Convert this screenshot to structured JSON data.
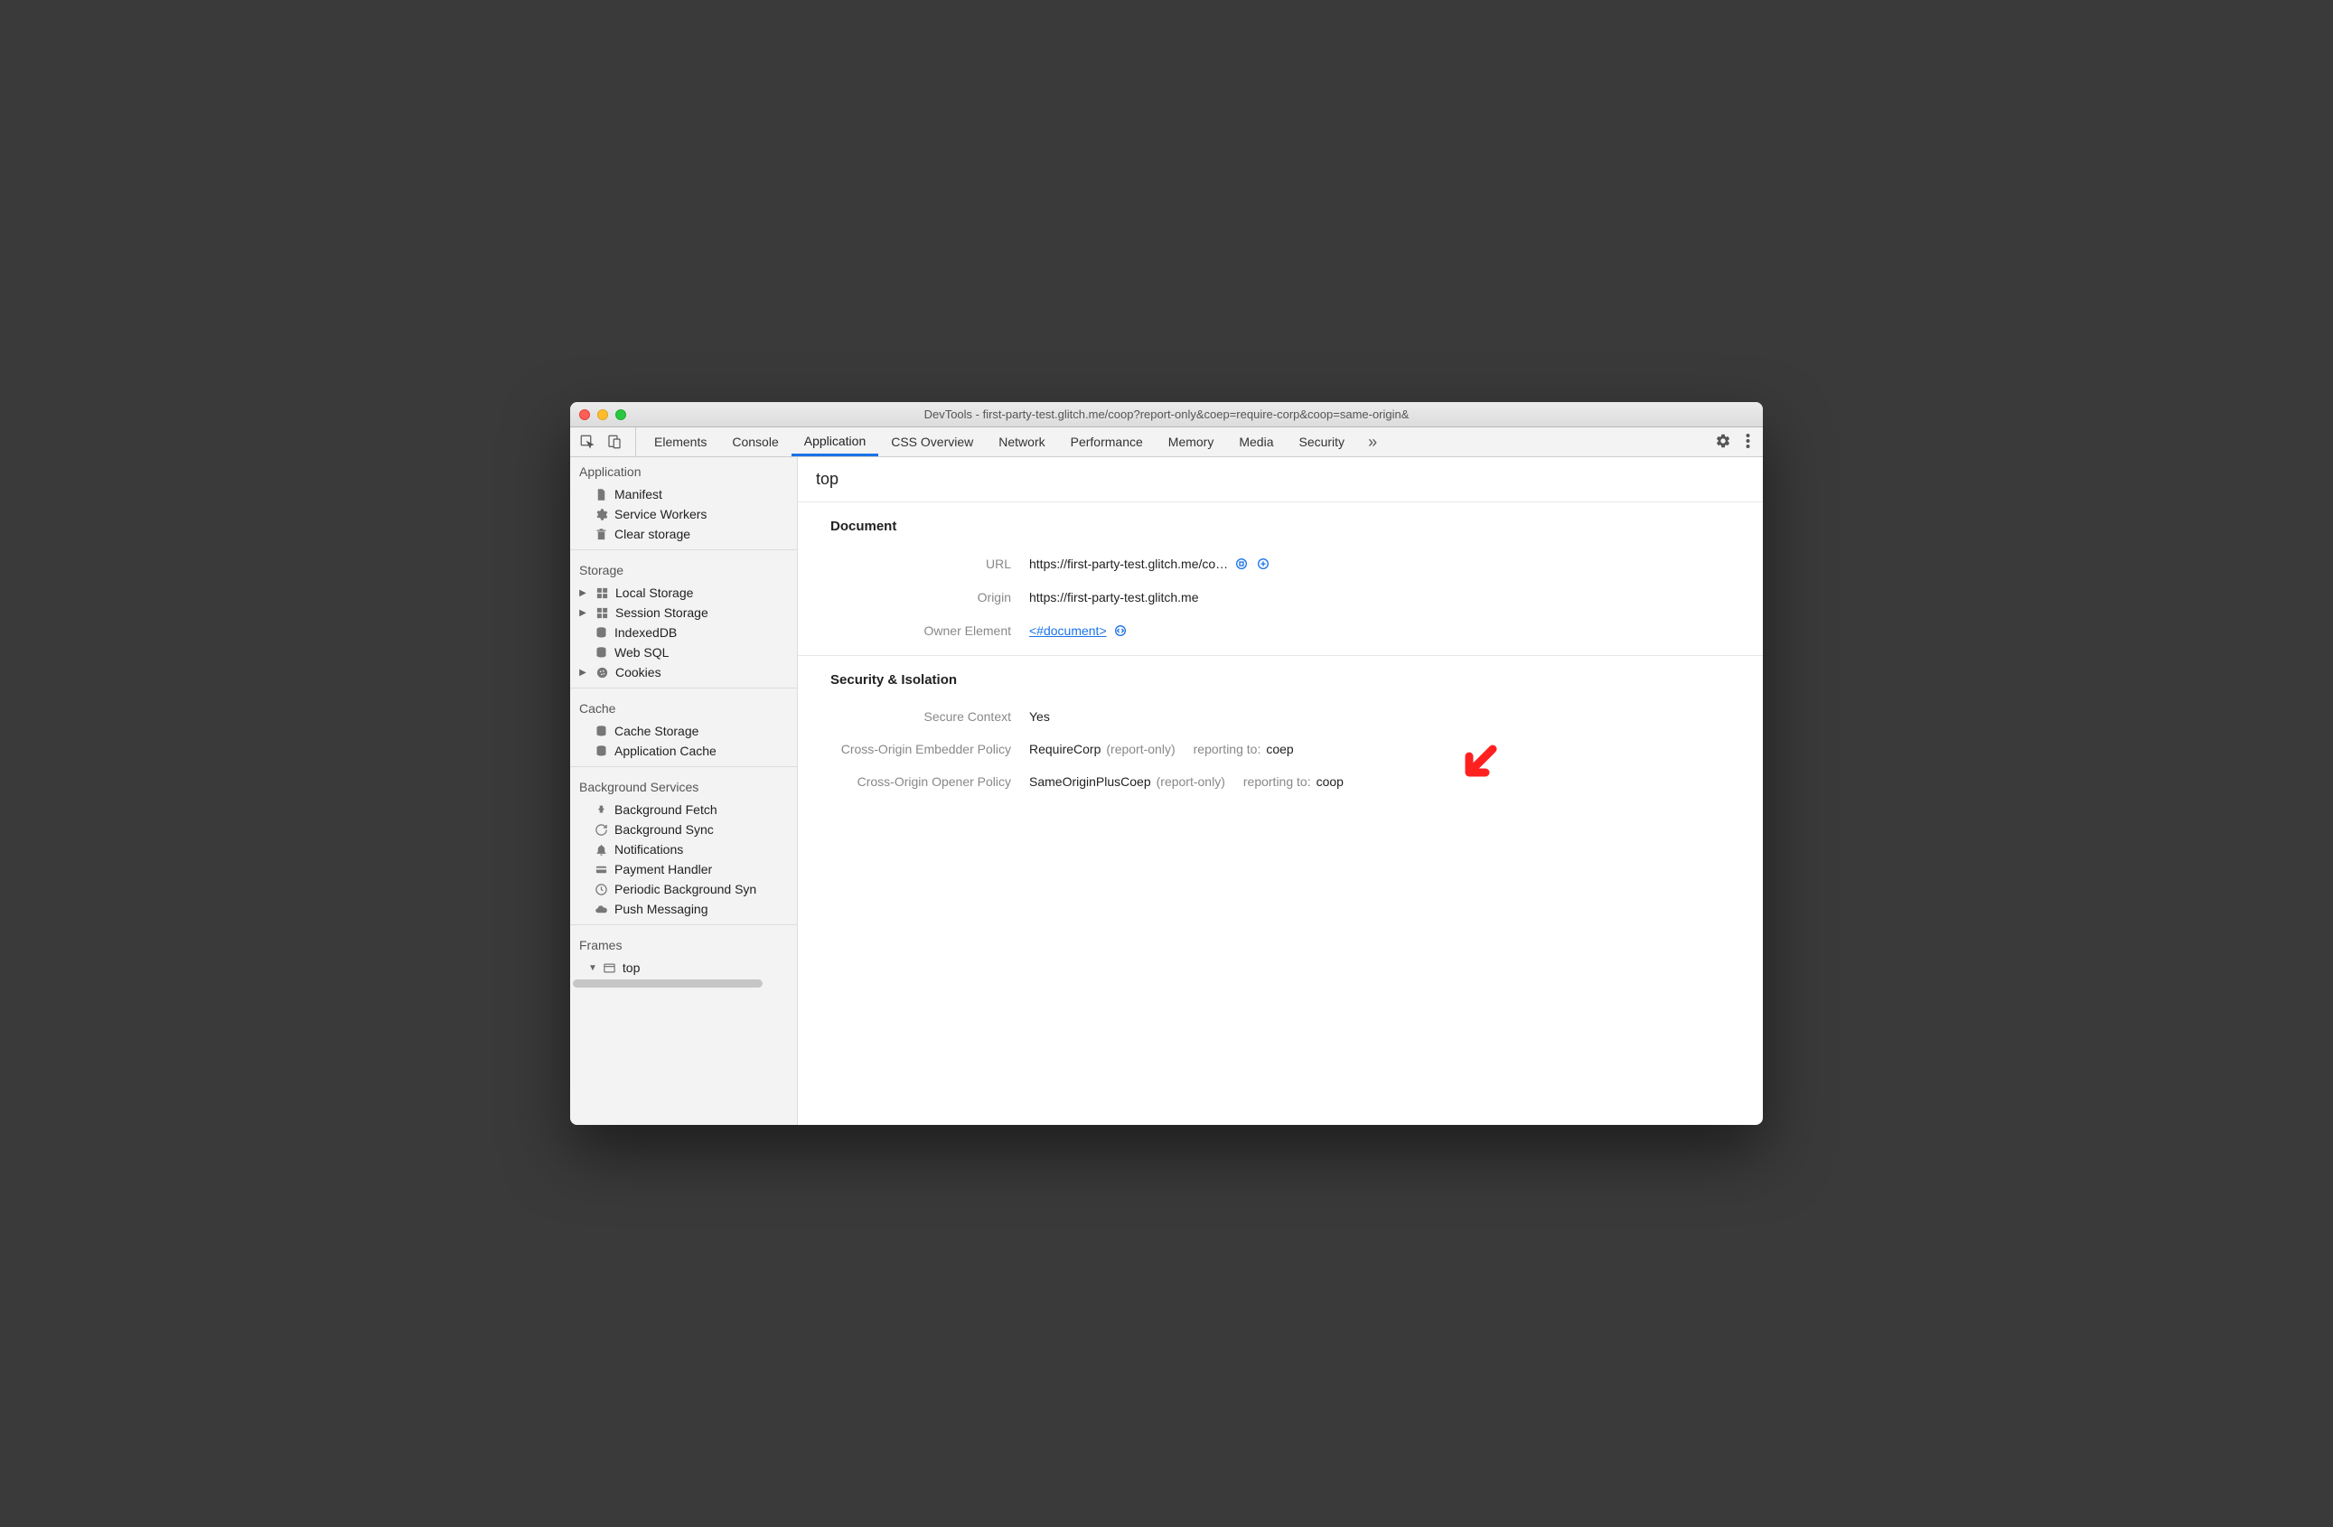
{
  "window": {
    "title": "DevTools - first-party-test.glitch.me/coop?report-only&coep=require-corp&coop=same-origin&"
  },
  "tabs": {
    "items": [
      "Elements",
      "Console",
      "Application",
      "CSS Overview",
      "Network",
      "Performance",
      "Memory",
      "Media",
      "Security"
    ],
    "active": "Application",
    "overflow": "»"
  },
  "sidebar": {
    "sections": {
      "application": {
        "title": "Application",
        "items": [
          "Manifest",
          "Service Workers",
          "Clear storage"
        ]
      },
      "storage": {
        "title": "Storage",
        "items": [
          "Local Storage",
          "Session Storage",
          "IndexedDB",
          "Web SQL",
          "Cookies"
        ]
      },
      "cache": {
        "title": "Cache",
        "items": [
          "Cache Storage",
          "Application Cache"
        ]
      },
      "background": {
        "title": "Background Services",
        "items": [
          "Background Fetch",
          "Background Sync",
          "Notifications",
          "Payment Handler",
          "Periodic Background Syn",
          "Push Messaging"
        ]
      },
      "frames": {
        "title": "Frames",
        "items": [
          "top"
        ]
      }
    }
  },
  "main": {
    "header": "top",
    "document": {
      "title": "Document",
      "rows": {
        "url_label": "URL",
        "url_value": "https://first-party-test.glitch.me/co…",
        "origin_label": "Origin",
        "origin_value": "https://first-party-test.glitch.me",
        "owner_label": "Owner Element",
        "owner_value": "<#document>"
      }
    },
    "security": {
      "title": "Security & Isolation",
      "rows": {
        "secure_label": "Secure Context",
        "secure_value": "Yes",
        "coep_label": "Cross-Origin Embedder Policy",
        "coep_value": "RequireCorp",
        "coep_mode": "(report-only)",
        "coep_reporting_label": "reporting to:",
        "coep_reporting_value": "coep",
        "coop_label": "Cross-Origin Opener Policy",
        "coop_value": "SameOriginPlusCoep",
        "coop_mode": "(report-only)",
        "coop_reporting_label": "reporting to:",
        "coop_reporting_value": "coop"
      }
    }
  }
}
